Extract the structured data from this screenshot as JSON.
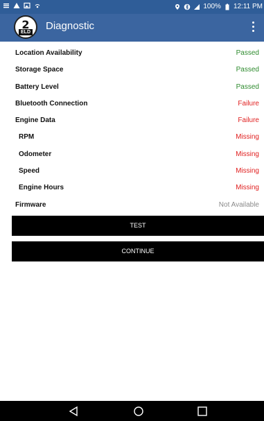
{
  "status_bar": {
    "battery_text": "100%",
    "time": "12:11 PM",
    "icons": [
      "notification-icon",
      "warning-icon",
      "image-icon",
      "signal-icon",
      "location-icon",
      "bluetooth-icon",
      "cell-signal-icon",
      "battery-icon"
    ]
  },
  "app_bar": {
    "logo_number": "2",
    "logo_text": "ELD",
    "title": "Diagnostic"
  },
  "diagnostics": [
    {
      "label": "Location Availability",
      "status": "Passed",
      "state": "passed"
    },
    {
      "label": "Storage Space",
      "status": "Passed",
      "state": "passed"
    },
    {
      "label": "Battery Level",
      "status": "Passed",
      "state": "passed"
    },
    {
      "label": "Bluetooth Connection",
      "status": "Failure",
      "state": "failure"
    },
    {
      "label": "Engine Data",
      "status": "Failure",
      "state": "failure"
    },
    {
      "label": "RPM",
      "status": "Missing",
      "state": "missing"
    },
    {
      "label": "Odometer",
      "status": "Missing",
      "state": "missing"
    },
    {
      "label": "Speed",
      "status": "Missing",
      "state": "missing"
    },
    {
      "label": "Engine Hours",
      "status": "Missing",
      "state": "missing"
    },
    {
      "label": "Firmware",
      "status": "Not Available",
      "state": "na"
    }
  ],
  "buttons": {
    "test": "TEST",
    "continue": "CONTINUE"
  },
  "colors": {
    "status_bar": "#2f5d98",
    "app_bar": "#3b65a0",
    "passed": "#2e8b2e",
    "failure": "#e02020",
    "not_available": "#8a8a8a"
  }
}
